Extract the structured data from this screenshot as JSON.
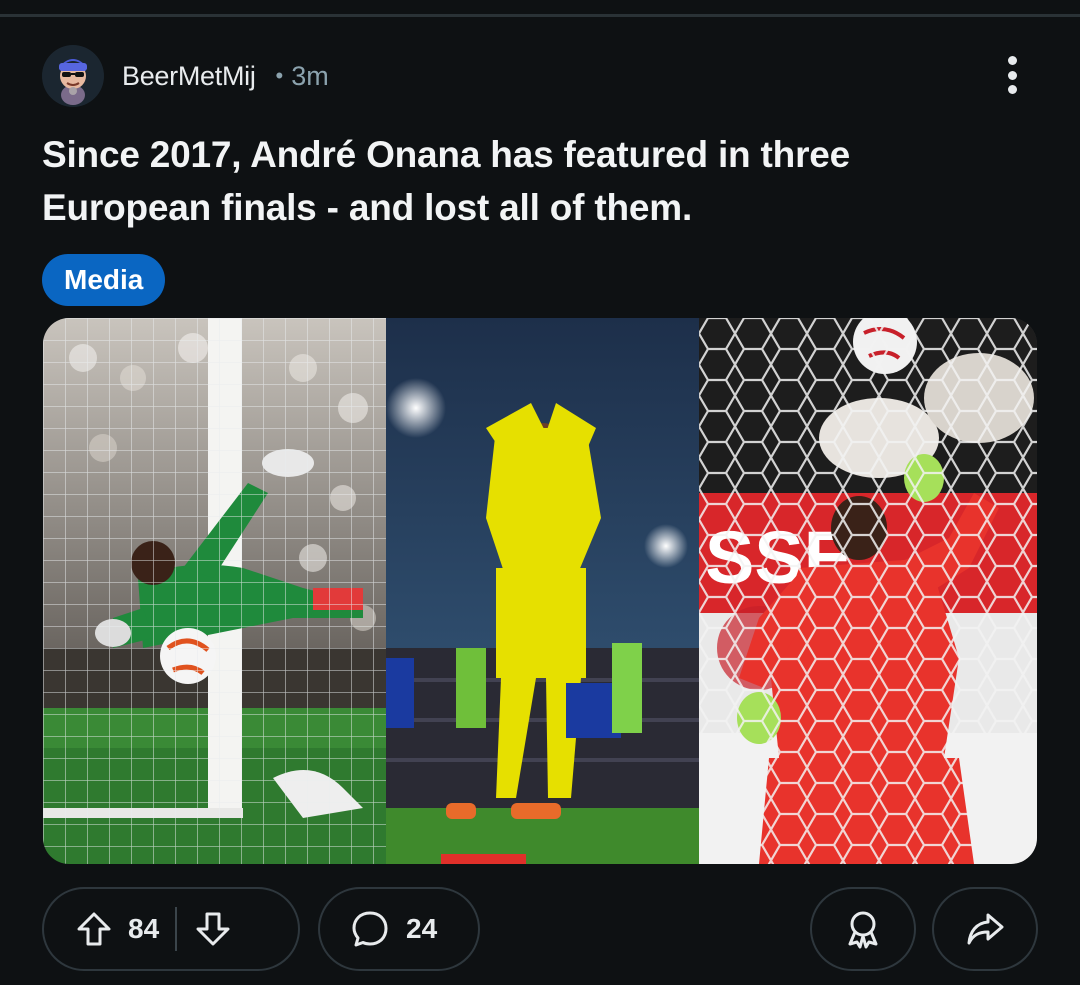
{
  "post": {
    "username": "BeerMetMij",
    "separator": "•",
    "timestamp": "3m",
    "title": "Since 2017, André Onana has featured in three European finals - and lost all of them.",
    "flair": "Media",
    "media_panels": [
      {
        "description_icon": "photo-goalkeeper-diving"
      },
      {
        "description_icon": "photo-goalkeeper-head-in-hands"
      },
      {
        "description_icon": "photo-goalkeeper-punching"
      }
    ]
  },
  "actions": {
    "upvote_count": "84",
    "comment_count": "24"
  },
  "icons": {
    "overflow": "kebab-menu-icon",
    "upvote": "arrow-up-icon",
    "downvote": "arrow-down-icon",
    "comment": "speech-bubble-icon",
    "award": "award-ribbon-icon",
    "share": "share-arrow-icon"
  },
  "colors": {
    "background": "#0e1113",
    "flair": "#0a66c2",
    "pill_border": "#2e373d",
    "muted_text": "#8ba2ad"
  }
}
